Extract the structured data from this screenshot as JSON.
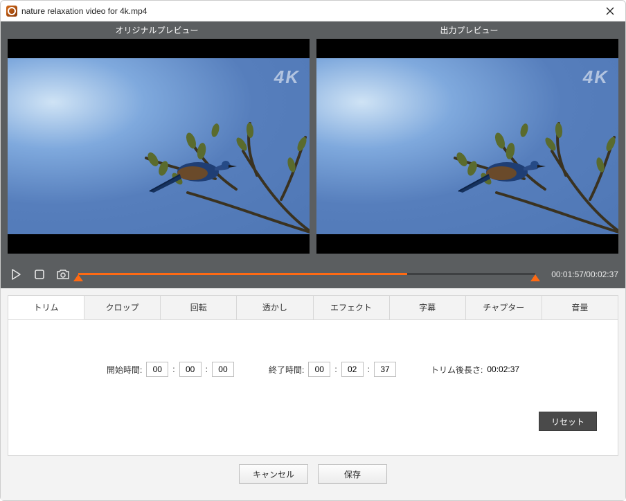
{
  "window": {
    "title": "nature relaxation video for 4k.mp4"
  },
  "preview": {
    "original_label": "オリジナルプレビュー",
    "output_label": "出力プレビュー",
    "watermark": "4K"
  },
  "playback": {
    "current": "00:01:57",
    "total": "00:02:37",
    "sep": "/",
    "selection_start_pct": 0,
    "selection_end_pct": 100,
    "played_pct": 72
  },
  "tabs": [
    {
      "id": "trim",
      "label": "トリム",
      "active": true
    },
    {
      "id": "crop",
      "label": "クロップ"
    },
    {
      "id": "rotate",
      "label": "回転"
    },
    {
      "id": "watermark",
      "label": "透かし"
    },
    {
      "id": "effect",
      "label": "エフェクト"
    },
    {
      "id": "subtitle",
      "label": "字幕"
    },
    {
      "id": "chapter",
      "label": "チャプター"
    },
    {
      "id": "volume",
      "label": "音量"
    }
  ],
  "trim": {
    "start_label": "開始時間:",
    "start": {
      "hh": "00",
      "mm": "00",
      "ss": "00"
    },
    "end_label": "終了時間:",
    "end": {
      "hh": "00",
      "mm": "02",
      "ss": "37"
    },
    "post_label": "トリム後長さ:",
    "post_value": "00:02:37",
    "reset": "リセット"
  },
  "footer": {
    "cancel": "キャンセル",
    "save": "保存"
  }
}
